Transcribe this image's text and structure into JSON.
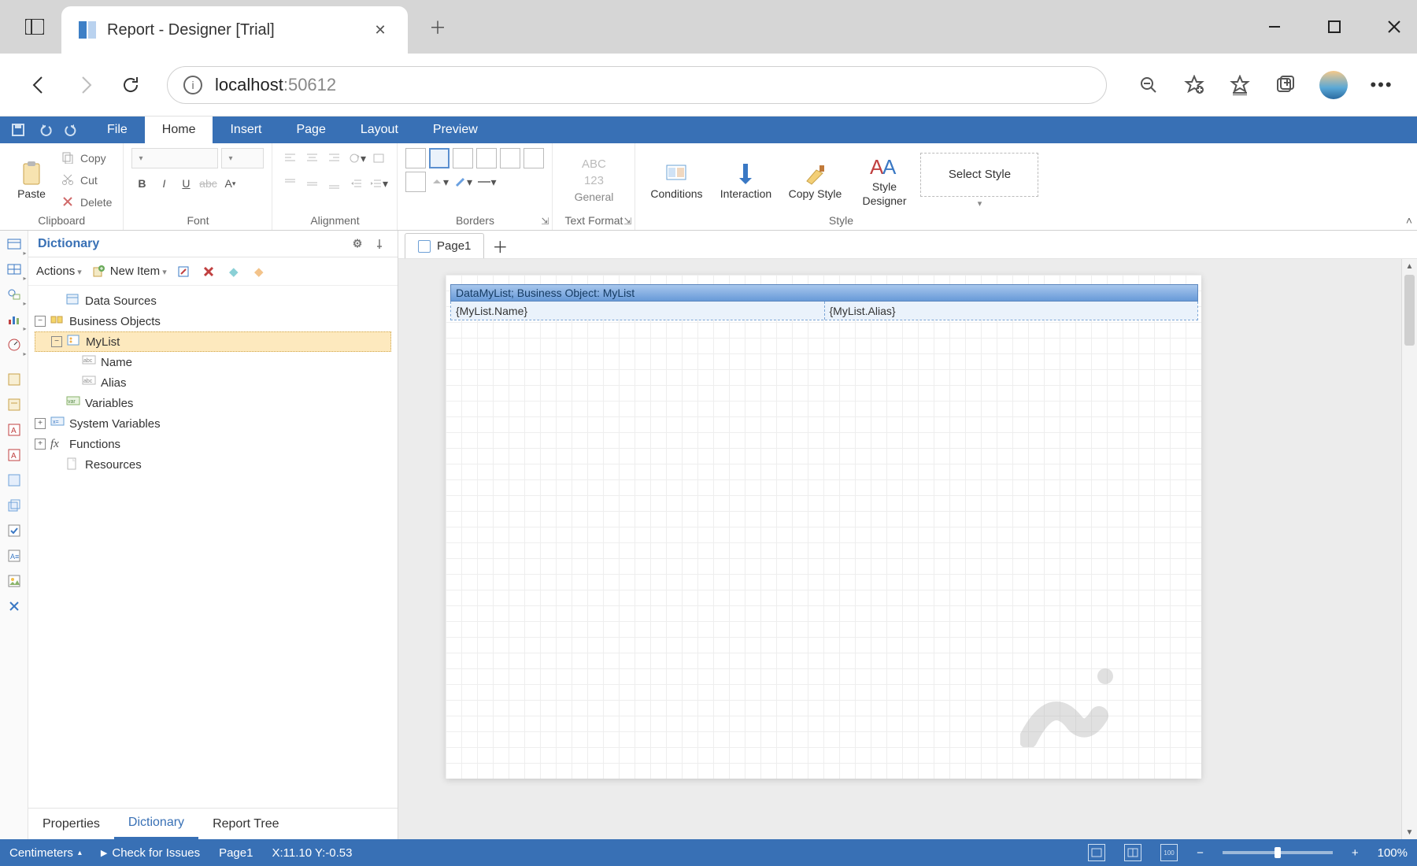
{
  "browser": {
    "tab_title": "Report - Designer [Trial]",
    "url_host": "localhost",
    "url_port": ":50612"
  },
  "menu": {
    "tabs": [
      "File",
      "Home",
      "Insert",
      "Page",
      "Layout",
      "Preview"
    ],
    "active": "Home"
  },
  "ribbon": {
    "clipboard": {
      "paste": "Paste",
      "copy": "Copy",
      "cut": "Cut",
      "delete": "Delete",
      "label": "Clipboard"
    },
    "font": {
      "label": "Font"
    },
    "alignment": {
      "label": "Alignment"
    },
    "borders": {
      "label": "Borders"
    },
    "textformat": {
      "example_top": "ABC",
      "example_num": "123",
      "general": "General",
      "label": "Text Format"
    },
    "style": {
      "conditions": "Conditions",
      "interaction": "Interaction",
      "copy": "Copy Style",
      "designer_l1": "Style",
      "designer_l2": "Designer",
      "selectbox": "Select Style",
      "label": "Style"
    }
  },
  "dictionary": {
    "title": "Dictionary",
    "actions": "Actions",
    "newitem": "New Item",
    "tree": {
      "data_sources": "Data Sources",
      "business_objects": "Business Objects",
      "mylist": "MyList",
      "name": "Name",
      "alias": "Alias",
      "variables": "Variables",
      "system_variables": "System Variables",
      "functions": "Functions",
      "resources": "Resources"
    },
    "bottom_tabs": [
      "Properties",
      "Dictionary",
      "Report Tree"
    ],
    "bottom_active": "Dictionary"
  },
  "canvas": {
    "page_tab": "Page1",
    "band_header": "DataMyList; Business Object: MyList",
    "cell_name": "{MyList.Name}",
    "cell_alias": "{MyList.Alias}"
  },
  "status": {
    "units": "Centimeters",
    "check": "Check for Issues",
    "page": "Page1",
    "coords": "X:11.10 Y:-0.53",
    "zoom": "100%"
  }
}
